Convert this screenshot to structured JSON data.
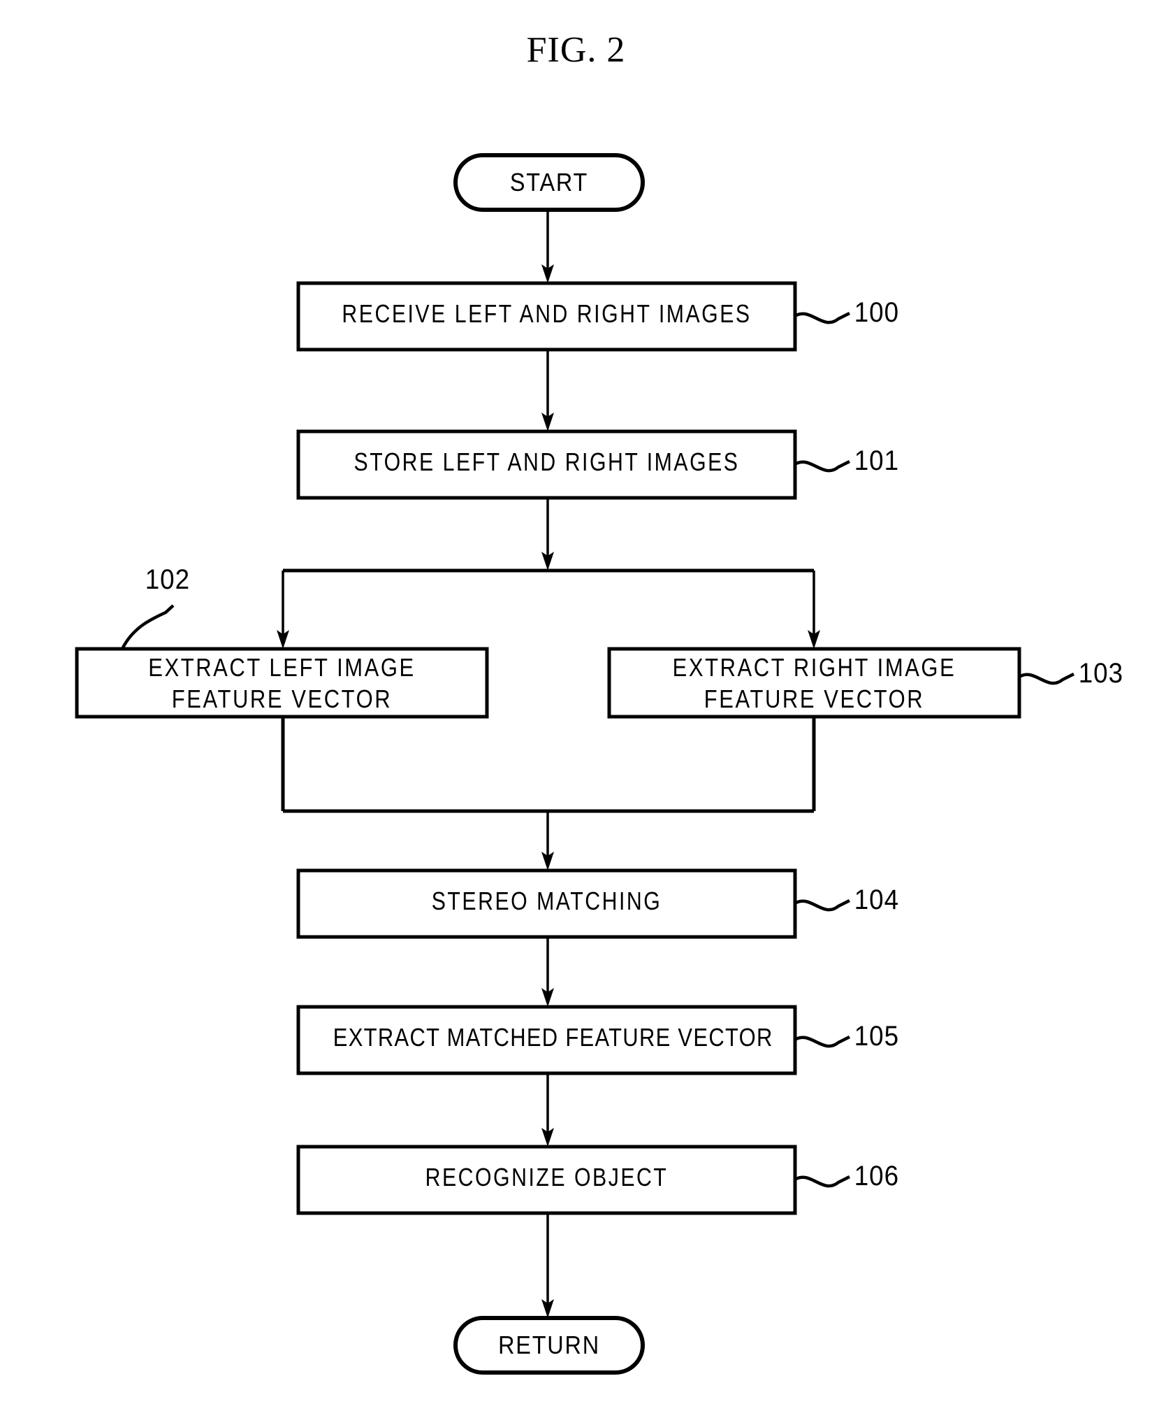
{
  "figure": {
    "title": "FIG. 2",
    "stroke_color": "#000000",
    "background_color": "#ffffff"
  },
  "nodes": {
    "start": {
      "label": "START",
      "shape": "stadium"
    },
    "step_100": {
      "label": "RECEIVE LEFT AND RIGHT IMAGES",
      "ref": "100",
      "shape": "process"
    },
    "step_101": {
      "label": "STORE LEFT AND RIGHT IMAGES",
      "ref": "101",
      "shape": "process"
    },
    "step_102": {
      "label_line1": "EXTRACT LEFT IMAGE",
      "label_line2": "FEATURE VECTOR",
      "ref": "102",
      "shape": "process"
    },
    "step_103": {
      "label_line1": "EXTRACT RIGHT IMAGE",
      "label_line2": "FEATURE VECTOR",
      "ref": "103",
      "shape": "process"
    },
    "step_104": {
      "label": "STEREO MATCHING",
      "ref": "104",
      "shape": "process"
    },
    "step_105": {
      "label": "EXTRACT MATCHED FEATURE VECTOR",
      "ref": "105",
      "shape": "process"
    },
    "step_106": {
      "label": "RECOGNIZE OBJECT",
      "ref": "106",
      "shape": "process"
    },
    "return": {
      "label": "RETURN",
      "shape": "stadium"
    }
  },
  "flow": {
    "sequence": [
      "start",
      "step_100",
      "step_101",
      "fork",
      "step_102",
      "step_103",
      "merge",
      "step_104",
      "step_105",
      "step_106",
      "return"
    ],
    "branch_from": "step_101",
    "branch_to": [
      "step_102",
      "step_103"
    ],
    "merge_to": "step_104"
  }
}
